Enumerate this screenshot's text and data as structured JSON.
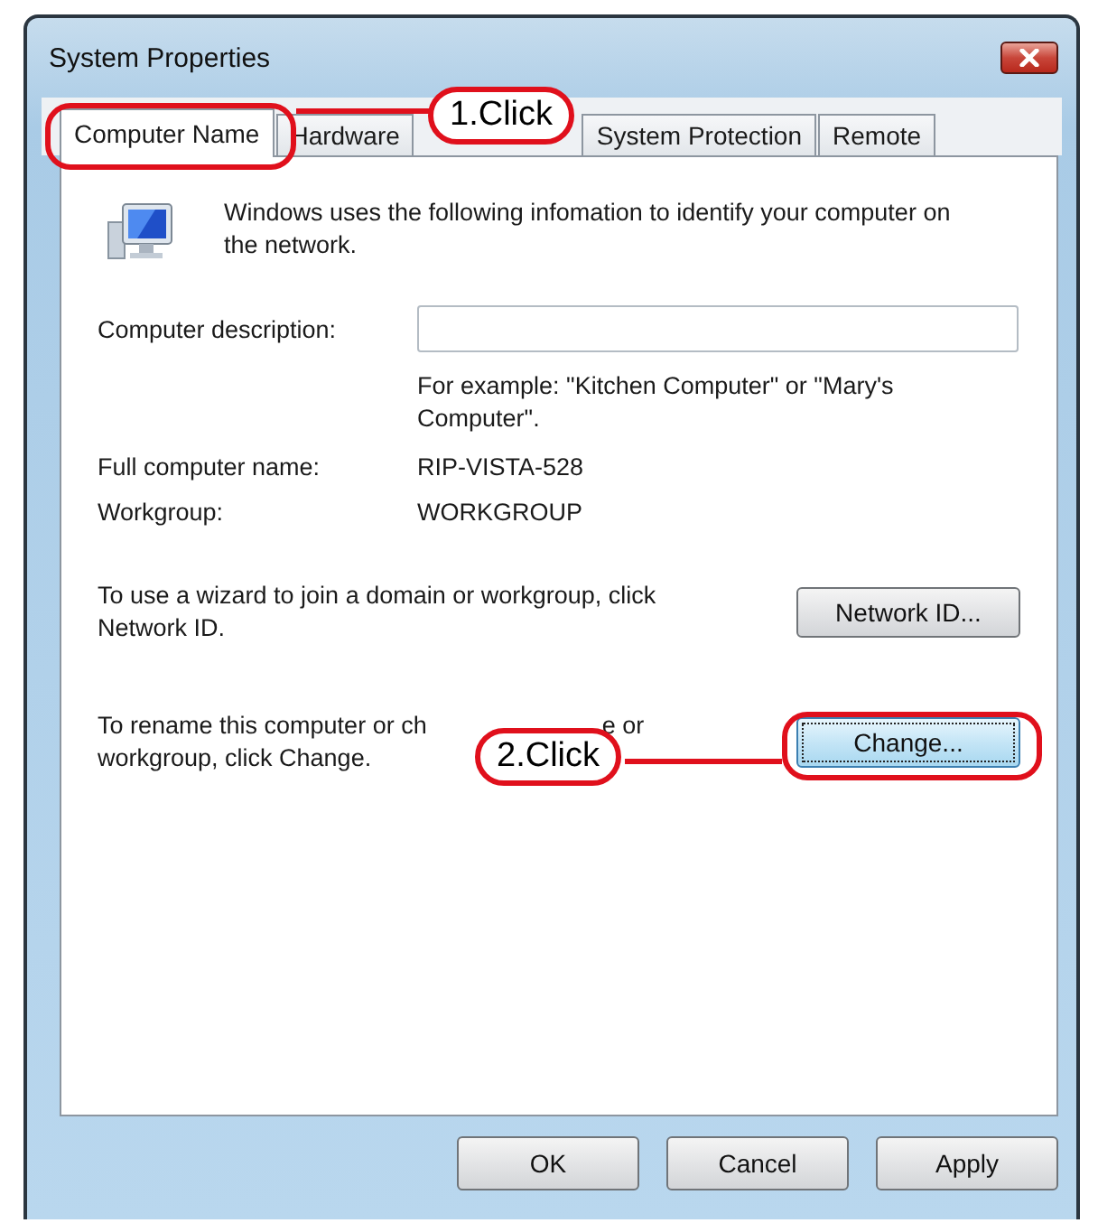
{
  "window": {
    "title": "System Properties"
  },
  "tabs": [
    {
      "label": "Computer Name",
      "selected": true,
      "callout": "1.Click"
    },
    {
      "label": "Hardware",
      "selected": false
    },
    {
      "label": "System Protection",
      "selected": false
    },
    {
      "label": "Remote",
      "selected": false
    }
  ],
  "intro": "Windows uses the following infomation to identify your computer on the network.",
  "description": {
    "label": "Computer description:",
    "hint": "For example: \"Kitchen Computer\" or \"Mary's Computer\"."
  },
  "info_rows": [
    {
      "label": "Full computer name:",
      "value": "RIP-VISTA-528"
    },
    {
      "label": "Workgroup:",
      "value": "WORKGROUP"
    }
  ],
  "actions": [
    {
      "text": "To use a wizard to join a domain or workgroup, click Network ID.",
      "button": "Network ID...",
      "focused": false
    },
    {
      "visible_text": [
        "To rename this computer or ch",
        "e or",
        "workgroup, click Change."
      ],
      "button": "Change...",
      "focused": true,
      "callout": "2.Click"
    }
  ],
  "buttons": [
    "OK",
    "Cancel",
    "Apply"
  ]
}
